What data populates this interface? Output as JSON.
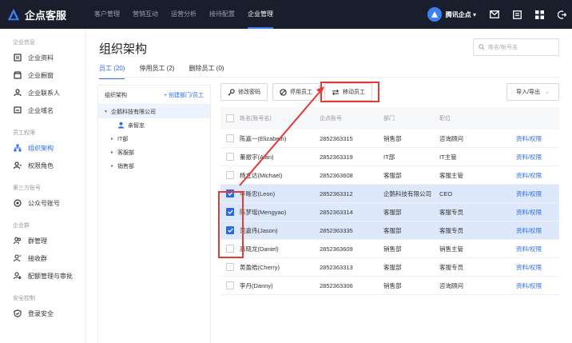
{
  "topbar": {
    "brand": "企点客服",
    "nav": [
      {
        "label": "客户管理",
        "active": false
      },
      {
        "label": "营销互动",
        "active": false
      },
      {
        "label": "运营分析",
        "active": false
      },
      {
        "label": "接待配置",
        "active": false
      },
      {
        "label": "企业管理",
        "active": true
      }
    ],
    "account_label": "腾讯企点 ▾"
  },
  "sidebar": {
    "sections": [
      {
        "title": "企业信息",
        "items": [
          {
            "label": "企业资料",
            "icon": "company-info-icon"
          },
          {
            "label": "企业橱窗",
            "icon": "storefront-icon"
          },
          {
            "label": "企业联系人",
            "icon": "contact-icon"
          },
          {
            "label": "企业域名",
            "icon": "domain-icon"
          }
        ]
      },
      {
        "title": "员工权限",
        "items": [
          {
            "label": "组织架构",
            "icon": "org-chart-icon",
            "active": true
          },
          {
            "label": "权限角色",
            "icon": "role-icon"
          }
        ]
      },
      {
        "title": "第三方账号",
        "items": [
          {
            "label": "公众号账号",
            "icon": "official-account-icon"
          }
        ]
      },
      {
        "title": "企业群",
        "items": [
          {
            "label": "群管理",
            "icon": "group-manage-icon"
          },
          {
            "label": "接收群",
            "icon": "receive-group-icon"
          },
          {
            "label": "配额管理与审批",
            "icon": "quota-icon"
          }
        ]
      },
      {
        "title": "安全控制",
        "items": [
          {
            "label": "登录安全",
            "icon": "shield-icon"
          }
        ]
      }
    ]
  },
  "main": {
    "title": "组织架构",
    "search_placeholder": "姓名/帐号名",
    "tabs": [
      {
        "label": "员工 (20)",
        "active": true
      },
      {
        "label": "停用员工 (2)",
        "active": false
      },
      {
        "label": "删除员工 (0)",
        "active": false
      }
    ],
    "tree": {
      "header": "组织架构",
      "create_label": "+ 创建部门/员工",
      "root": "企鹅科技有限公司",
      "member": "亲智忠",
      "children": [
        "IT部",
        "客服部",
        "销售部"
      ]
    },
    "toolbar": {
      "reset_password": "修改密码",
      "disable": "停用员工",
      "move": "移动员工",
      "import_export": "导入/导出"
    },
    "table": {
      "headers": [
        "姓名(账号名)",
        "企点账号",
        "部门",
        "职位",
        ""
      ],
      "rows": [
        {
          "name": "陈嘉一(Elizabeth)",
          "account": "2852363315",
          "dept": "销售部",
          "position": "咨询顾问",
          "action": "资料/权限",
          "checked": false
        },
        {
          "name": "董振宇(Alan)",
          "account": "2852363319",
          "dept": "IT部",
          "position": "IT主管",
          "action": "资料/权限",
          "checked": false
        },
        {
          "name": "杨立达(Michael)",
          "account": "2852363608",
          "dept": "客服部",
          "position": "客服主管",
          "action": "资料/权限",
          "checked": false
        },
        {
          "name": "李晰忠(Leon)",
          "account": "2852363312",
          "dept": "企鹅科技有限公司",
          "position": "CEO",
          "action": "资料/权限",
          "checked": true
        },
        {
          "name": "陈梦瑶(Mengyao)",
          "account": "2852363314",
          "dept": "客服部",
          "position": "客服专员",
          "action": "资料/权限",
          "checked": true
        },
        {
          "name": "范嘉伟(Jason)",
          "account": "2852363335",
          "dept": "客服部",
          "position": "客服专员",
          "action": "资料/权限",
          "checked": true
        },
        {
          "name": "高晓龙(Daniel)",
          "account": "2852363609",
          "dept": "销售部",
          "position": "销售主管",
          "action": "资料/权限",
          "checked": false
        },
        {
          "name": "黄盈皓(Cherry)",
          "account": "2852363313",
          "dept": "客服部",
          "position": "客服专员",
          "action": "资料/权限",
          "checked": false
        },
        {
          "name": "李丹(Danny)",
          "account": "2852363306",
          "dept": "销售部",
          "position": "咨询顾问",
          "action": "资料/权限",
          "checked": false
        }
      ]
    }
  },
  "colors": {
    "accent": "#2a6ae9",
    "topbar_bg": "#1a1d2b",
    "selected_row": "#dde8fb",
    "annotation_red": "#e53935"
  }
}
